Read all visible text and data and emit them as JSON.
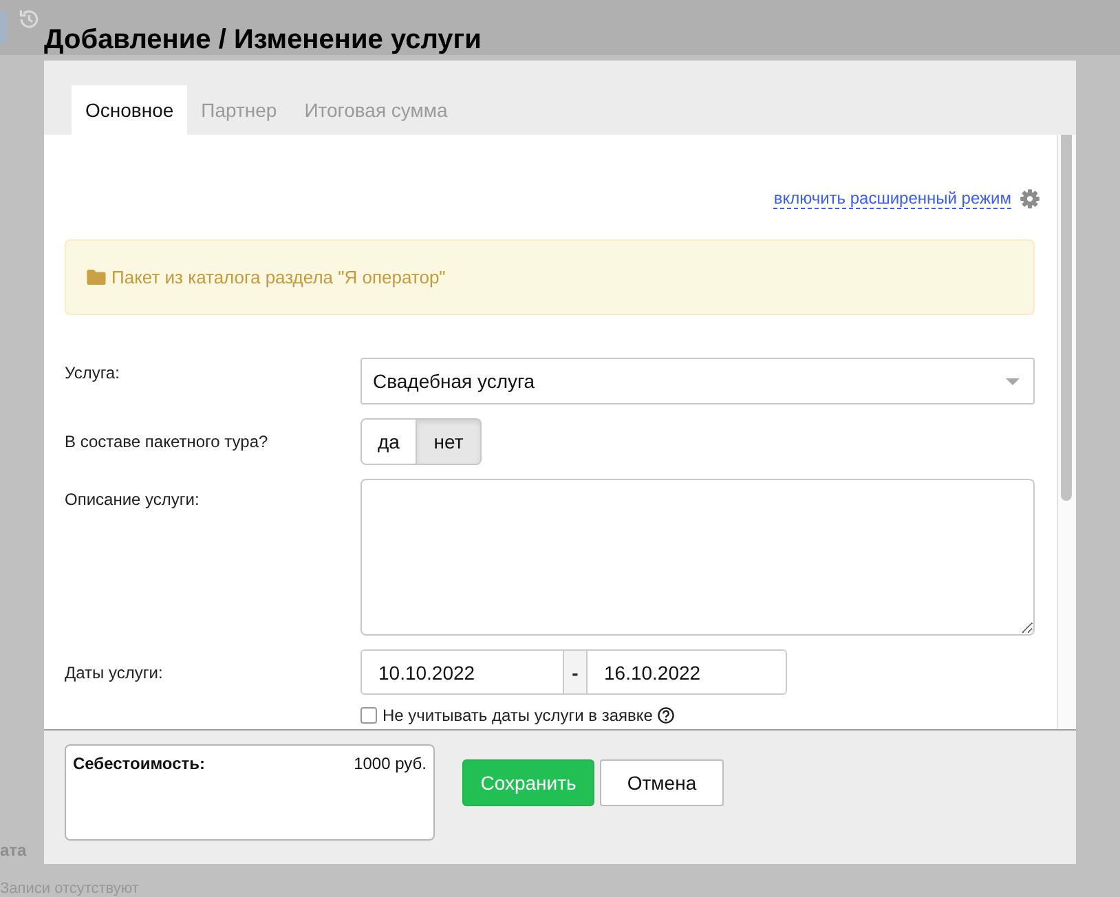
{
  "background_page": {
    "column_header": "ата",
    "empty_message": "Записи отсутствуют"
  },
  "dialog": {
    "title": "Добавление / Изменение услуги",
    "tabs": [
      {
        "label": "Основное",
        "selected": true
      },
      {
        "label": "Партнер",
        "selected": false
      },
      {
        "label": "Итоговая сумма",
        "selected": false
      }
    ],
    "advanced_mode_link": "включить расширенный режим",
    "notice": "Пакет из каталога раздела \"Я оператор\"",
    "fields": [
      {
        "kind": "select",
        "label": "Услуга:",
        "value": "Свадебная услуга"
      },
      {
        "kind": "toggle",
        "label": "В составе пакетного тура?",
        "options": [
          {
            "label": "да",
            "selected": false
          },
          {
            "label": "нет",
            "selected": true
          }
        ]
      },
      {
        "kind": "textarea",
        "label": "Описание услуги:"
      },
      {
        "kind": "date_range",
        "label": "Даты услуги:",
        "from": "10.10.2022",
        "separator": "-",
        "to": "16.10.2022"
      }
    ],
    "ignore_dates_checkbox": {
      "label": "Не учитывать даты услуги в заявке",
      "checked": false
    },
    "cost": {
      "label": "Себестоимость:",
      "value": "1000 руб."
    },
    "buttons": [
      {
        "label": "Сохранить",
        "kind": "primary"
      },
      {
        "label": "Отмена",
        "kind": "default"
      }
    ]
  }
}
